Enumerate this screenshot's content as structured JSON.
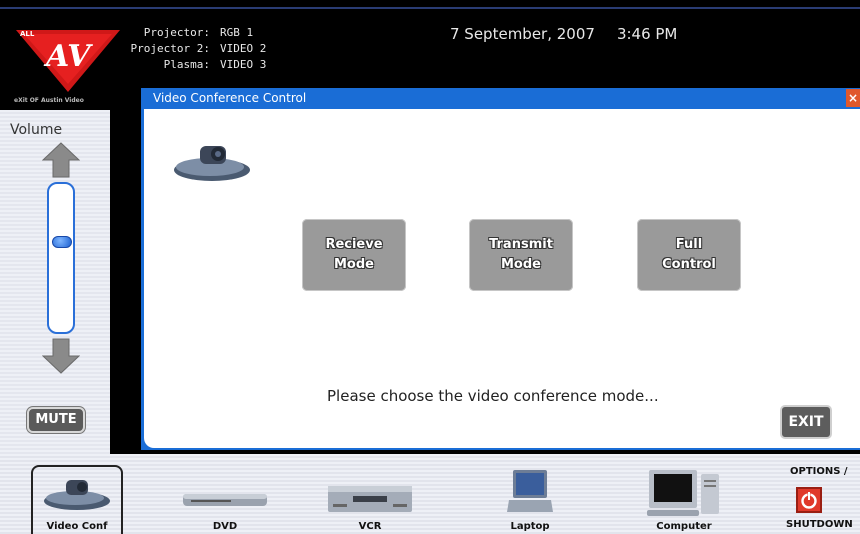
{
  "header": {
    "projectors": [
      {
        "label": "Projector:",
        "value": "RGB 1"
      },
      {
        "label": "Projector 2:",
        "value": "VIDEO 2"
      },
      {
        "label": "Plasma:",
        "value": "VIDEO 3"
      }
    ],
    "date": "7 September, 2007",
    "time": "3:46 PM",
    "logo_text": "ALL AV",
    "tagline": "eXit OF Austin Video"
  },
  "volume": {
    "label": "Volume",
    "level": 0.62,
    "mute_label": "MUTE"
  },
  "dialog": {
    "title": "Video Conference Control",
    "close_label": "×",
    "buttons": [
      {
        "line1": "Recieve",
        "line2": "Mode"
      },
      {
        "line1": "Transmit",
        "line2": "Mode"
      },
      {
        "line1": "Full",
        "line2": "Control"
      }
    ],
    "prompt": "Please choose the video conference mode...",
    "exit_label": "EXIT"
  },
  "devices": [
    {
      "label": "Video Conf",
      "icon": "video-conf-icon"
    },
    {
      "label": "DVD",
      "icon": "dvd-icon"
    },
    {
      "label": "VCR",
      "icon": "vcr-icon"
    },
    {
      "label": "Laptop",
      "icon": "laptop-icon"
    },
    {
      "label": "Computer",
      "icon": "computer-icon"
    }
  ],
  "options": {
    "top_label": "OPTIONS /",
    "bottom_label": "SHUTDOWN",
    "icon": "power-icon"
  },
  "colors": {
    "accent": "#1a6dd6",
    "button_gray": "#9a9a9a",
    "shutdown_red": "#e0392a"
  }
}
